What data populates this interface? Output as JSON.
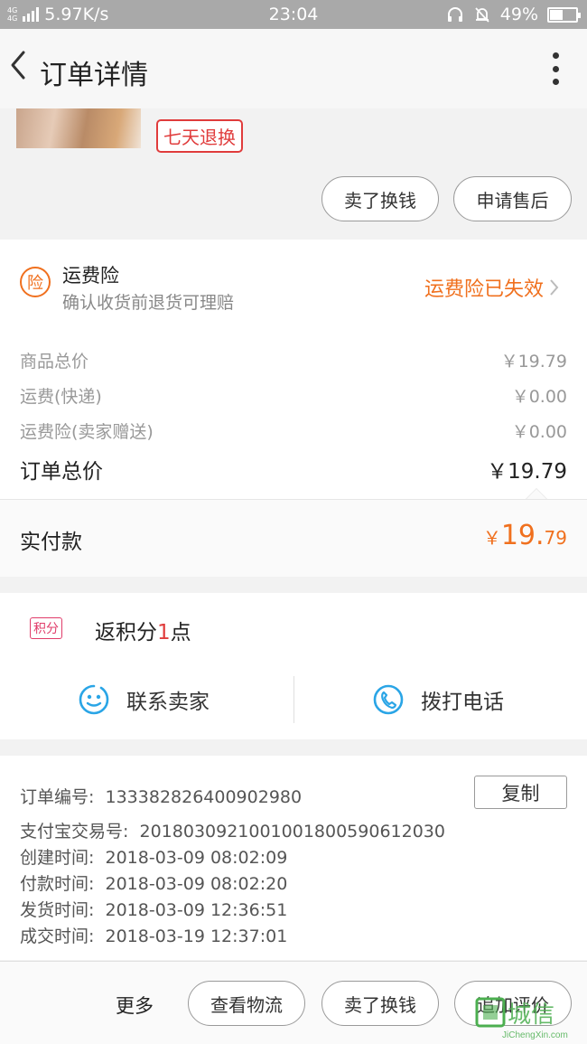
{
  "status_bar": {
    "network": "4G 4G",
    "speed": "5.97K/s",
    "time": "23:04",
    "battery": "49%",
    "battery_level": 0.49
  },
  "header": {
    "title": "订单详情"
  },
  "product": {
    "return_tag": "七天退换",
    "sell_button": "卖了换钱",
    "after_sale_button": "申请售后"
  },
  "insurance": {
    "icon_char": "险",
    "title": "运费险",
    "subtitle": "确认收货前退货可理赔",
    "status": "运费险已失效"
  },
  "prices": [
    {
      "label": "商品总价",
      "value": "￥19.79"
    },
    {
      "label": "运费(快递)",
      "value": "￥0.00"
    },
    {
      "label": "运费险(卖家赠送)",
      "value": "￥0.00"
    }
  ],
  "total": {
    "label": "订单总价",
    "value": "￥19.79"
  },
  "paid": {
    "label": "实付款",
    "symbol": "￥",
    "integer": "19.",
    "decimal": "79"
  },
  "points": {
    "tag": "积分",
    "prefix": "返积分",
    "count": "1",
    "suffix": "点"
  },
  "contact": {
    "seller": "联系卖家",
    "phone": "拨打电话"
  },
  "order_info": {
    "order_no_label": "订单编号:",
    "order_no": "133382826400902980",
    "copy_button": "复制",
    "alipay_label": "支付宝交易号:",
    "alipay_no": "2018030921001001800590612030",
    "rows": [
      {
        "label": "创建时间:",
        "value": "2018-03-09 08:02:09"
      },
      {
        "label": "付款时间:",
        "value": "2018-03-09 08:02:20"
      },
      {
        "label": "发货时间:",
        "value": "2018-03-09 12:36:51"
      },
      {
        "label": "成交时间:",
        "value": "2018-03-19 12:37:01"
      }
    ]
  },
  "bottom_bar": {
    "more": "更多",
    "logistics": "查看物流",
    "sell": "卖了换钱",
    "add_review": "追加评价"
  },
  "watermark": {
    "chinese": "城信",
    "latin": "JiChengXin.com"
  },
  "colors": {
    "accent_orange": "#f0701e",
    "red": "#e03c3c",
    "points_pink": "#e03c6a",
    "icon_blue": "#2aa5e6"
  }
}
